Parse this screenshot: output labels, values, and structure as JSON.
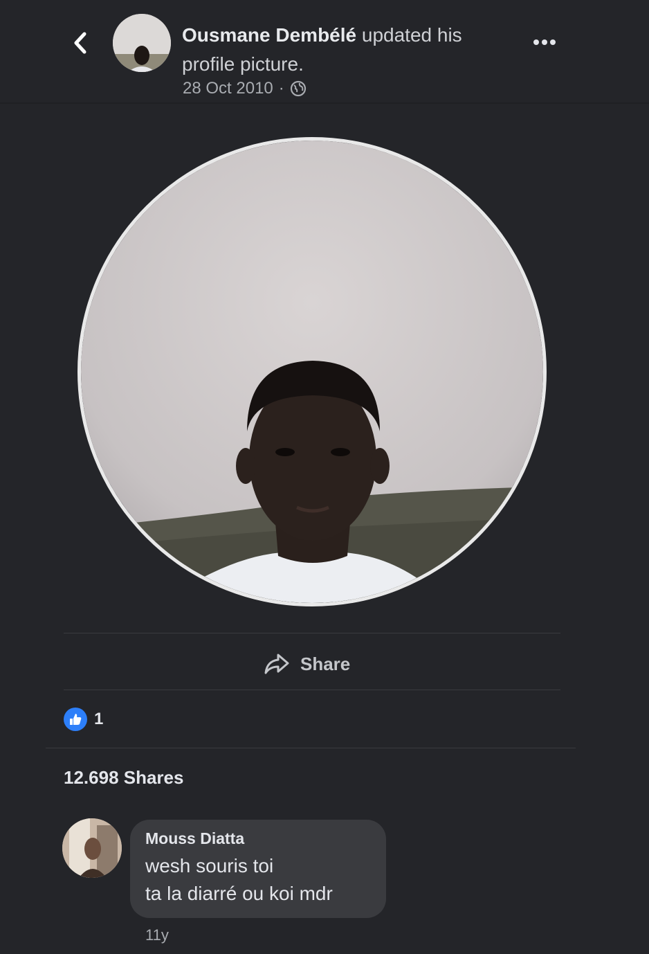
{
  "post": {
    "author": "Ousmane Dembélé",
    "action": " updated his profile picture.",
    "date": "28 Oct 2010",
    "separator": "·",
    "privacy_icon": "globe-icon"
  },
  "actions": {
    "share_label": "Share",
    "share_icon": "share-arrow-icon"
  },
  "reactions": {
    "type": "like",
    "count": "1"
  },
  "shares": {
    "label": "12.698 Shares"
  },
  "comment": {
    "author": "Mouss Diatta",
    "lines": [
      "wesh souris  toi",
      "ta la diarré ou koi mdr"
    ],
    "time": "11y"
  },
  "colors": {
    "background": "#242529",
    "bubble": "#3a3b3f",
    "like_blue": "#2d7ff9",
    "text_primary": "#e4e6eb",
    "text_secondary": "#a9acb1"
  }
}
